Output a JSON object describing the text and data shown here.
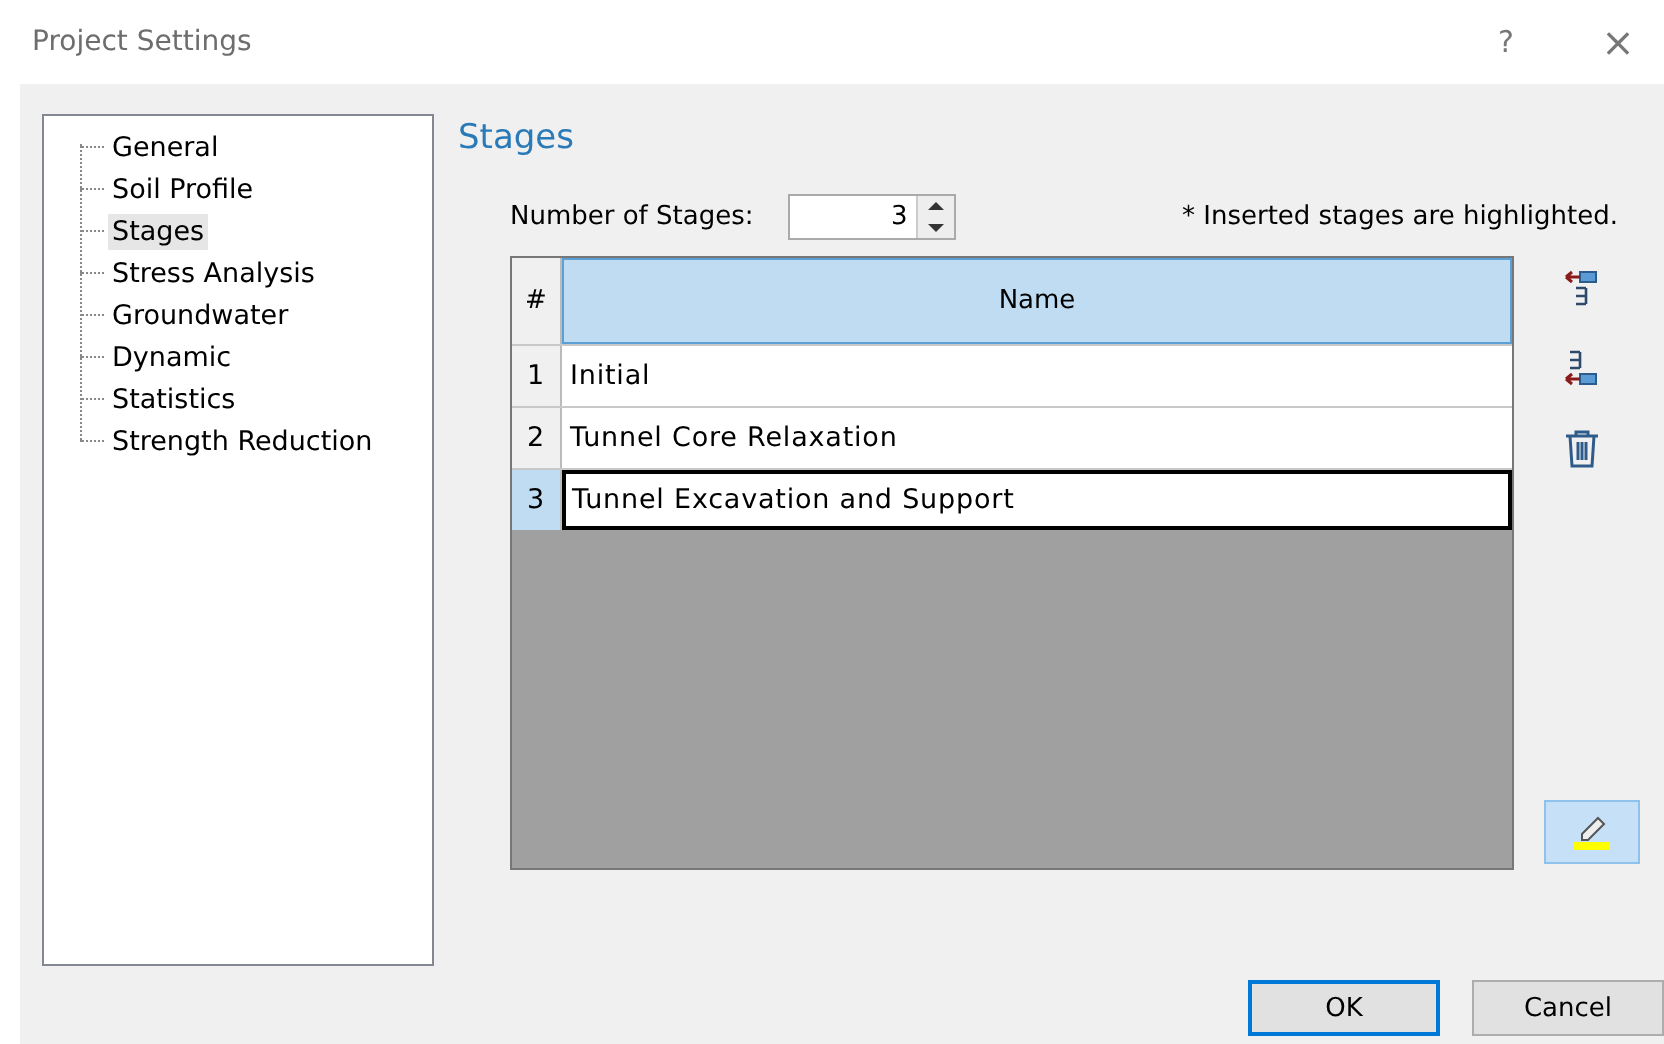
{
  "window": {
    "title": "Project Settings",
    "help": "?",
    "close": "×"
  },
  "sidebar": {
    "items": [
      {
        "label": "General",
        "selected": false
      },
      {
        "label": "Soil Profile",
        "selected": false
      },
      {
        "label": "Stages",
        "selected": true
      },
      {
        "label": "Stress Analysis",
        "selected": false
      },
      {
        "label": "Groundwater",
        "selected": false
      },
      {
        "label": "Dynamic",
        "selected": false
      },
      {
        "label": "Statistics",
        "selected": false
      },
      {
        "label": "Strength Reduction",
        "selected": false
      }
    ]
  },
  "heading": "Stages",
  "stage_count": {
    "label": "Number of Stages:",
    "value": "3"
  },
  "note": "* Inserted stages are highlighted.",
  "table": {
    "columns": [
      "#",
      "Name"
    ],
    "rows": [
      {
        "number": "1",
        "name": "Initial",
        "selected": false
      },
      {
        "number": "2",
        "name": "Tunnel Core Relaxation",
        "selected": false
      },
      {
        "number": "3",
        "name": "Tunnel Excavation and Support",
        "selected": true
      }
    ]
  },
  "buttons": [
    {
      "label": "OK",
      "default": true
    },
    {
      "label": "Cancel",
      "default": false
    }
  ]
}
